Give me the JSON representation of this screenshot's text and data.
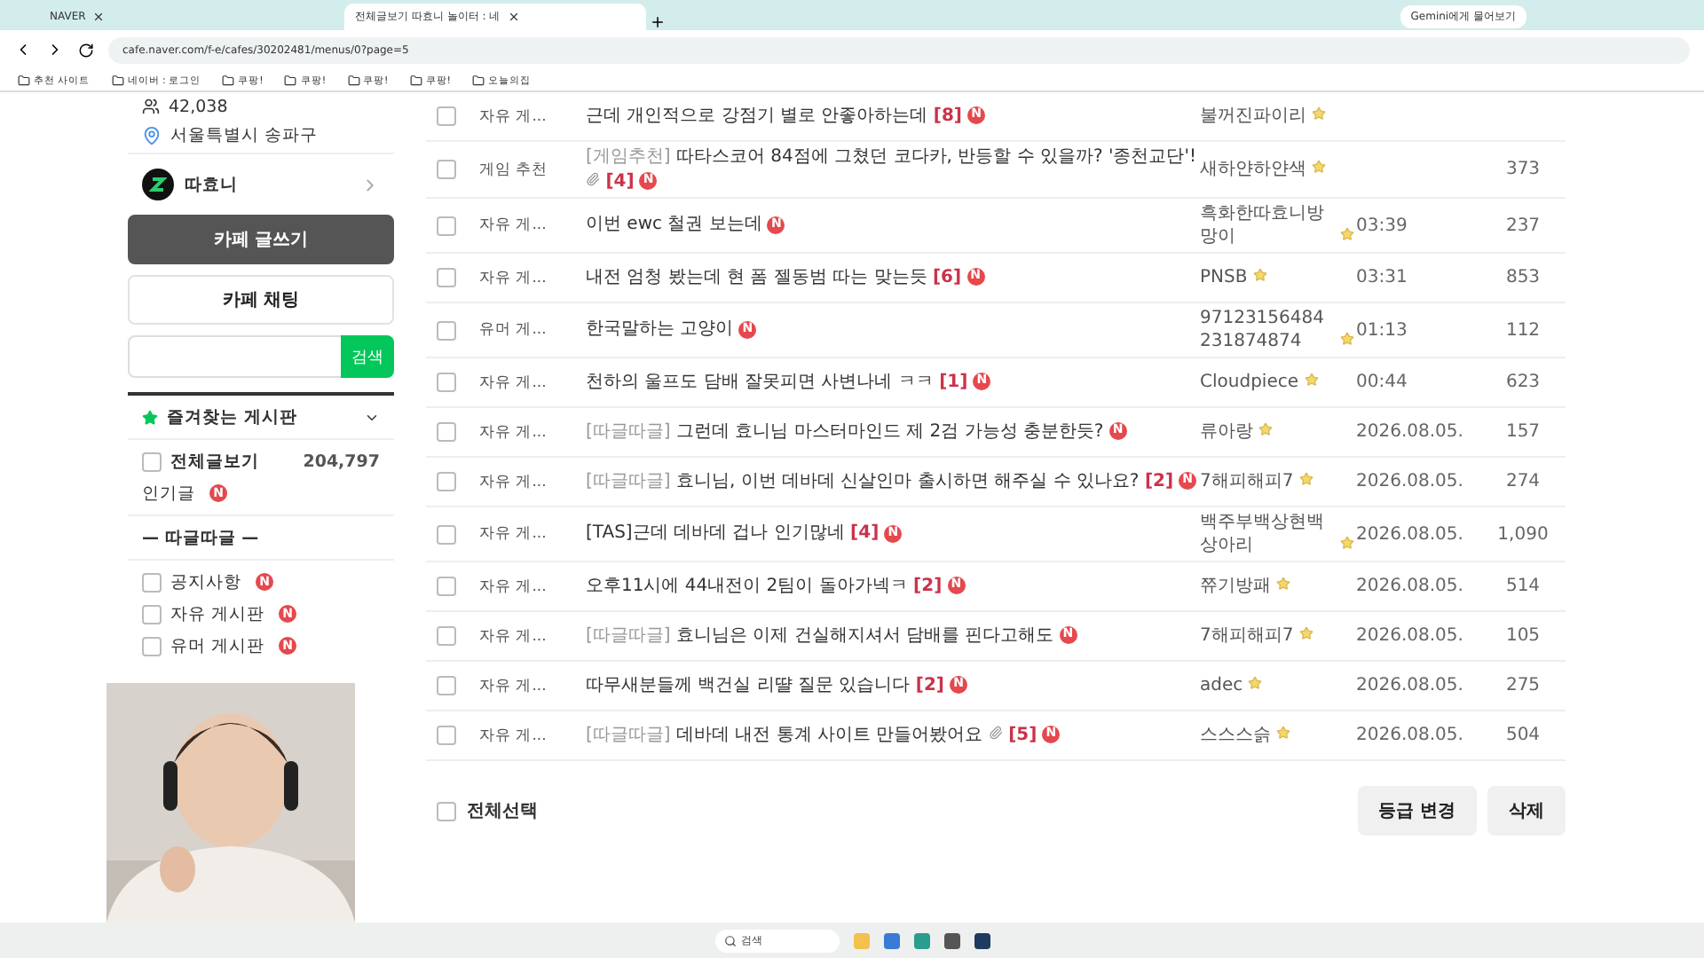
{
  "browser": {
    "tabs": [
      {
        "label": "NAVER",
        "selected": false
      },
      {
        "label": "전체글보기 따효니 놀이터 : 네",
        "selected": true
      }
    ],
    "address": "cafe.naver.com/f-e/cafes/30202481/menus/0?page=5",
    "assistant_button": "Gemini에게 물어보기",
    "bookmarks": [
      "추천 사이트",
      "네이버 : 로그인",
      "쿠팡!",
      "쿠팡!",
      "쿠팡!",
      "쿠팡!",
      "오늘의집"
    ]
  },
  "sidebar": {
    "member_count": "42,038",
    "location": "서울특별시 송파구",
    "cafe_name": "따효니",
    "write_button": "카페 글쓰기",
    "chat_button": "카페 채팅",
    "search_button": "검색",
    "favorites_title": "즐겨찾는 게시판",
    "all_posts": {
      "label": "전체글보기",
      "count": "204,797"
    },
    "popular": {
      "label": "인기글",
      "badge": "N"
    },
    "group_title": "— 따글따글 —",
    "boards": [
      {
        "label": "공지사항",
        "badge": "N"
      },
      {
        "label": "자유 게시판",
        "badge": "N"
      },
      {
        "label": "유머 게시판",
        "badge": "N"
      }
    ]
  },
  "posts": [
    {
      "checked": false,
      "board": "자유 게...",
      "title": "근데 개인적으로 강점기 별로 안좋아하는데",
      "comments": "[8]",
      "badge": "N",
      "author": "불꺼진파이리"
    },
    {
      "checked": false,
      "board": "게임 추천",
      "prefix": "[게임추천]",
      "title": "따타스코어 84점에 그쳤던 코다카, 반등할 수 있을까? '종천교단'!",
      "attachment": true,
      "comments": "[4]",
      "badge": "N",
      "author": "새하얀하얀색",
      "views": "373"
    },
    {
      "checked": false,
      "board": "자유 게...",
      "title": "이번 ewc 철권 보는데",
      "badge": "N",
      "author": "흑화한따효니방망이",
      "date": "03:39",
      "views": "237"
    },
    {
      "checked": false,
      "board": "자유 게...",
      "title": "내전 엄청 봤는데 현 폼 젤동범 따는 맞는듯",
      "comments": "[6]",
      "badge": "N",
      "author": "PNSB",
      "date": "03:31",
      "views": "853"
    },
    {
      "checked": false,
      "board": "유머 게...",
      "title": "한국말하는 고양이",
      "badge": "N",
      "author": "97123156484231874874",
      "date": "01:13",
      "views": "112"
    },
    {
      "checked": false,
      "board": "자유 게...",
      "title": "천하의 울프도 담배 잘못피면 사변나네 ㅋㅋ",
      "comments": "[1]",
      "badge": "N",
      "author": "Cloudpiece",
      "date": "00:44",
      "views": "623"
    },
    {
      "checked": false,
      "board": "자유 게...",
      "prefix": "[따글따글]",
      "title": "그런데 효니님 마스터마인드 제 2검 가능성 충분한듯?",
      "badge": "N",
      "author": "류아랑",
      "date": "2026.08.05.",
      "views": "157"
    },
    {
      "checked": false,
      "board": "자유 게...",
      "prefix": "[따글따글]",
      "title": "효니님, 이번 데바데 신살인마 출시하면 해주실 수 있나요?",
      "comments": "[2]",
      "badge": "N",
      "author": "7해피해피7",
      "date": "2026.08.05.",
      "views": "274"
    },
    {
      "checked": false,
      "board": "자유 게...",
      "title": "[TAS]근데 데바데 겁나 인기많네",
      "comments": "[4]",
      "badge": "N",
      "author": "백주부백상현백상아리",
      "date": "2026.08.05.",
      "views": "1,090"
    },
    {
      "checked": false,
      "board": "자유 게...",
      "title": "오후11시에 44내전이 2팀이 돌아가넥ㅋ",
      "comments": "[2]",
      "badge": "N",
      "author": "쮸기방패",
      "date": "2026.08.05.",
      "views": "514"
    },
    {
      "checked": false,
      "board": "자유 게...",
      "prefix": "[따글따글]",
      "title": "효니님은 이제 건실해지셔서 담배를 핀다고해도",
      "badge": "N",
      "author": "7해피해피7",
      "date": "2026.08.05.",
      "views": "105"
    },
    {
      "checked": false,
      "board": "자유 게...",
      "title": "따무새분들께 백건실 리땰 질문 있습니다",
      "comments": "[2]",
      "badge": "N",
      "author": "adec",
      "date": "2026.08.05.",
      "views": "275"
    },
    {
      "checked": false,
      "board": "자유 게...",
      "prefix": "[따글따글]",
      "title": "데바데 내전 통계 사이트 만들어봤어요",
      "attachment": true,
      "comments": "[5]",
      "badge": "N",
      "author": "스스스슭",
      "date": "2026.08.05.",
      "views": "504"
    }
  ],
  "footer": {
    "select_all": {
      "label": "전체선택",
      "checked": false
    },
    "buttons": [
      "등급 변경",
      "삭제"
    ]
  },
  "taskbar": {
    "search": "검색"
  }
}
